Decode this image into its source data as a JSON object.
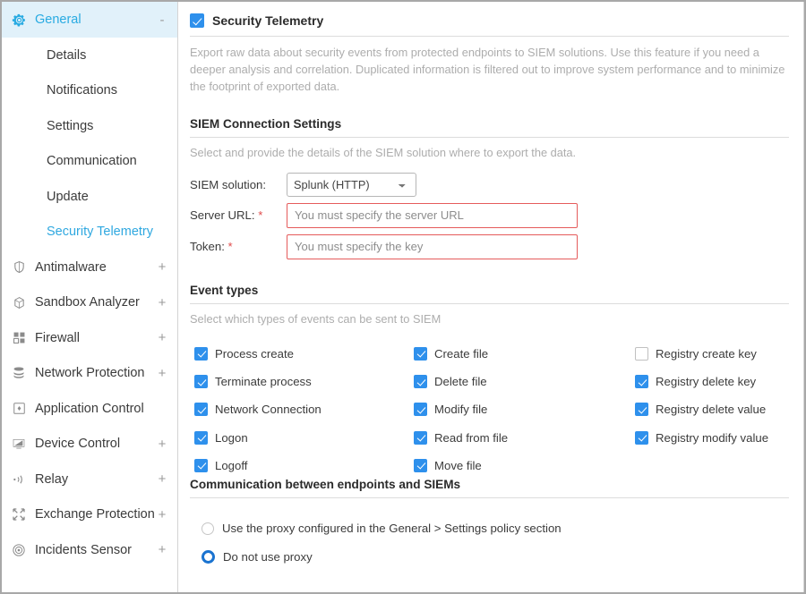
{
  "sidebar": {
    "group": {
      "label": "General",
      "icon": "gear-icon",
      "expander": "-"
    },
    "sub_items": [
      {
        "label": "Details",
        "active": false
      },
      {
        "label": "Notifications",
        "active": false
      },
      {
        "label": "Settings",
        "active": false
      },
      {
        "label": "Communication",
        "active": false
      },
      {
        "label": "Update",
        "active": false
      },
      {
        "label": "Security Telemetry",
        "active": true
      }
    ],
    "items": [
      {
        "label": "Antimalware",
        "icon": "shield-icon",
        "expander": "+"
      },
      {
        "label": "Sandbox Analyzer",
        "icon": "cube-icon",
        "expander": "+"
      },
      {
        "label": "Firewall",
        "icon": "firewall-blocks-icon",
        "expander": "+"
      },
      {
        "label": "Network Protection",
        "icon": "stack-layers-icon",
        "expander": "+"
      },
      {
        "label": "Application Control",
        "icon": "application-window-icon",
        "expander": ""
      },
      {
        "label": "Device Control",
        "icon": "monitor-icon",
        "expander": "+"
      },
      {
        "label": "Relay",
        "icon": "broadcast-icon",
        "expander": "+"
      },
      {
        "label": "Exchange Protection",
        "icon": "exchange-icon",
        "expander": "+"
      },
      {
        "label": "Incidents Sensor",
        "icon": "sensor-target-icon",
        "expander": "+"
      }
    ]
  },
  "main": {
    "master": {
      "label": "Security Telemetry",
      "checked": true
    },
    "description": "Export raw data about security events from protected endpoints to SIEM solutions. Use this feature if you need a deeper analysis and correlation. Duplicated information is filtered out to improve system performance and to minimize the footprint of exported data.",
    "connection": {
      "title": "SIEM Connection Settings",
      "subtitle": "Select and provide the details of the SIEM solution where to export the data.",
      "siem_solution_label": "SIEM solution:",
      "siem_solution_value": "Splunk (HTTP)",
      "siem_solution_options": [
        "Splunk (HTTP)"
      ],
      "server_url_label": "Server URL:",
      "server_url_required": "*",
      "server_url_value": "",
      "server_url_placeholder": "You must specify the server URL",
      "token_label": "Token:",
      "token_required": "*",
      "token_value": "",
      "token_placeholder": "You must specify the key"
    },
    "event_types": {
      "title": "Event types",
      "subtitle": "Select which types of events can be sent to SIEM",
      "columns": [
        [
          {
            "label": "Process create",
            "checked": true
          },
          {
            "label": "Terminate process",
            "checked": true
          },
          {
            "label": "Network Connection",
            "checked": true
          },
          {
            "label": "Logon",
            "checked": true
          },
          {
            "label": "Logoff",
            "checked": true
          }
        ],
        [
          {
            "label": "Create file",
            "checked": true
          },
          {
            "label": "Delete file",
            "checked": true
          },
          {
            "label": "Modify file",
            "checked": true
          },
          {
            "label": "Read from file",
            "checked": true
          },
          {
            "label": "Move file",
            "checked": true
          }
        ],
        [
          {
            "label": "Registry create key",
            "checked": false
          },
          {
            "label": "Registry delete key",
            "checked": true
          },
          {
            "label": "Registry delete value",
            "checked": true
          },
          {
            "label": "Registry modify value",
            "checked": true
          }
        ]
      ]
    },
    "communication": {
      "title": "Communication between endpoints and SIEMs",
      "options": [
        {
          "label": "Use the proxy configured in the General > Settings policy section",
          "selected": false
        },
        {
          "label": "Do not use proxy",
          "selected": true
        }
      ]
    }
  },
  "colors": {
    "accent_blue": "#29abe2",
    "checkbox_blue": "#2e90ec",
    "radio_blue": "#1a73d0",
    "error_red": "#e55b5b",
    "sidebar_active_bg": "#e1f1fa",
    "muted_text": "#adadad"
  }
}
